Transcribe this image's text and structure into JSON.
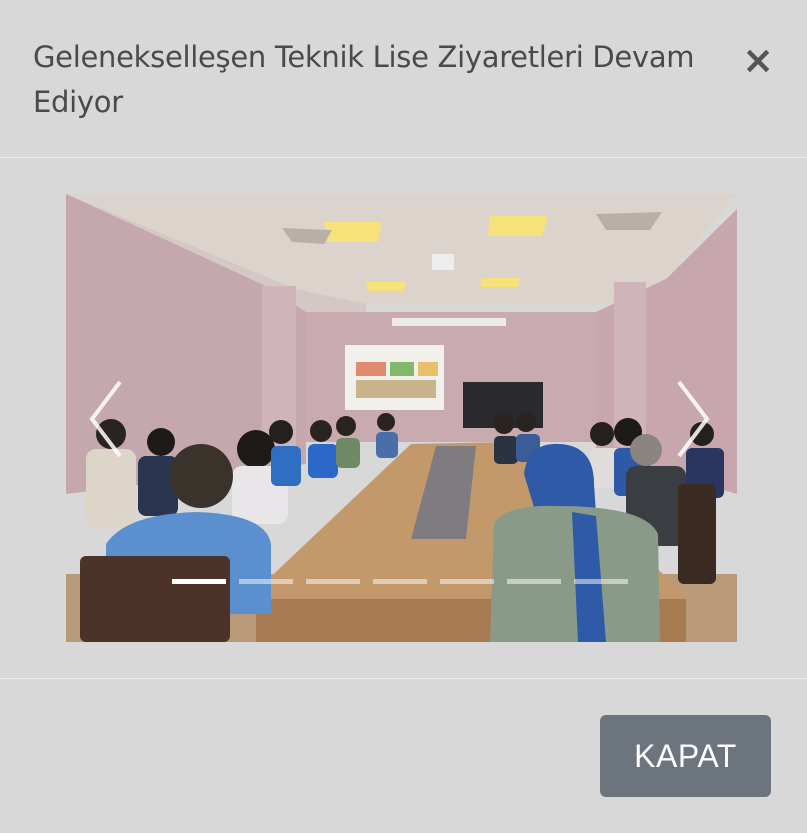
{
  "modal": {
    "title": "Geleneksellesen Teknik Lise Ziyaretleri Devam Ediyor",
    "close_symbol": "×"
  },
  "carousel": {
    "image_label": "photo",
    "slide_count": 7,
    "active_index": 0,
    "prev_icon": "chevron-left-icon",
    "next_icon": "chevron-right-icon"
  },
  "footer": {
    "close_button_label": "KAPAT"
  },
  "colors": {
    "background": "#d8d8d8",
    "button": "#6c757d",
    "title_text": "#4a4a4a"
  }
}
